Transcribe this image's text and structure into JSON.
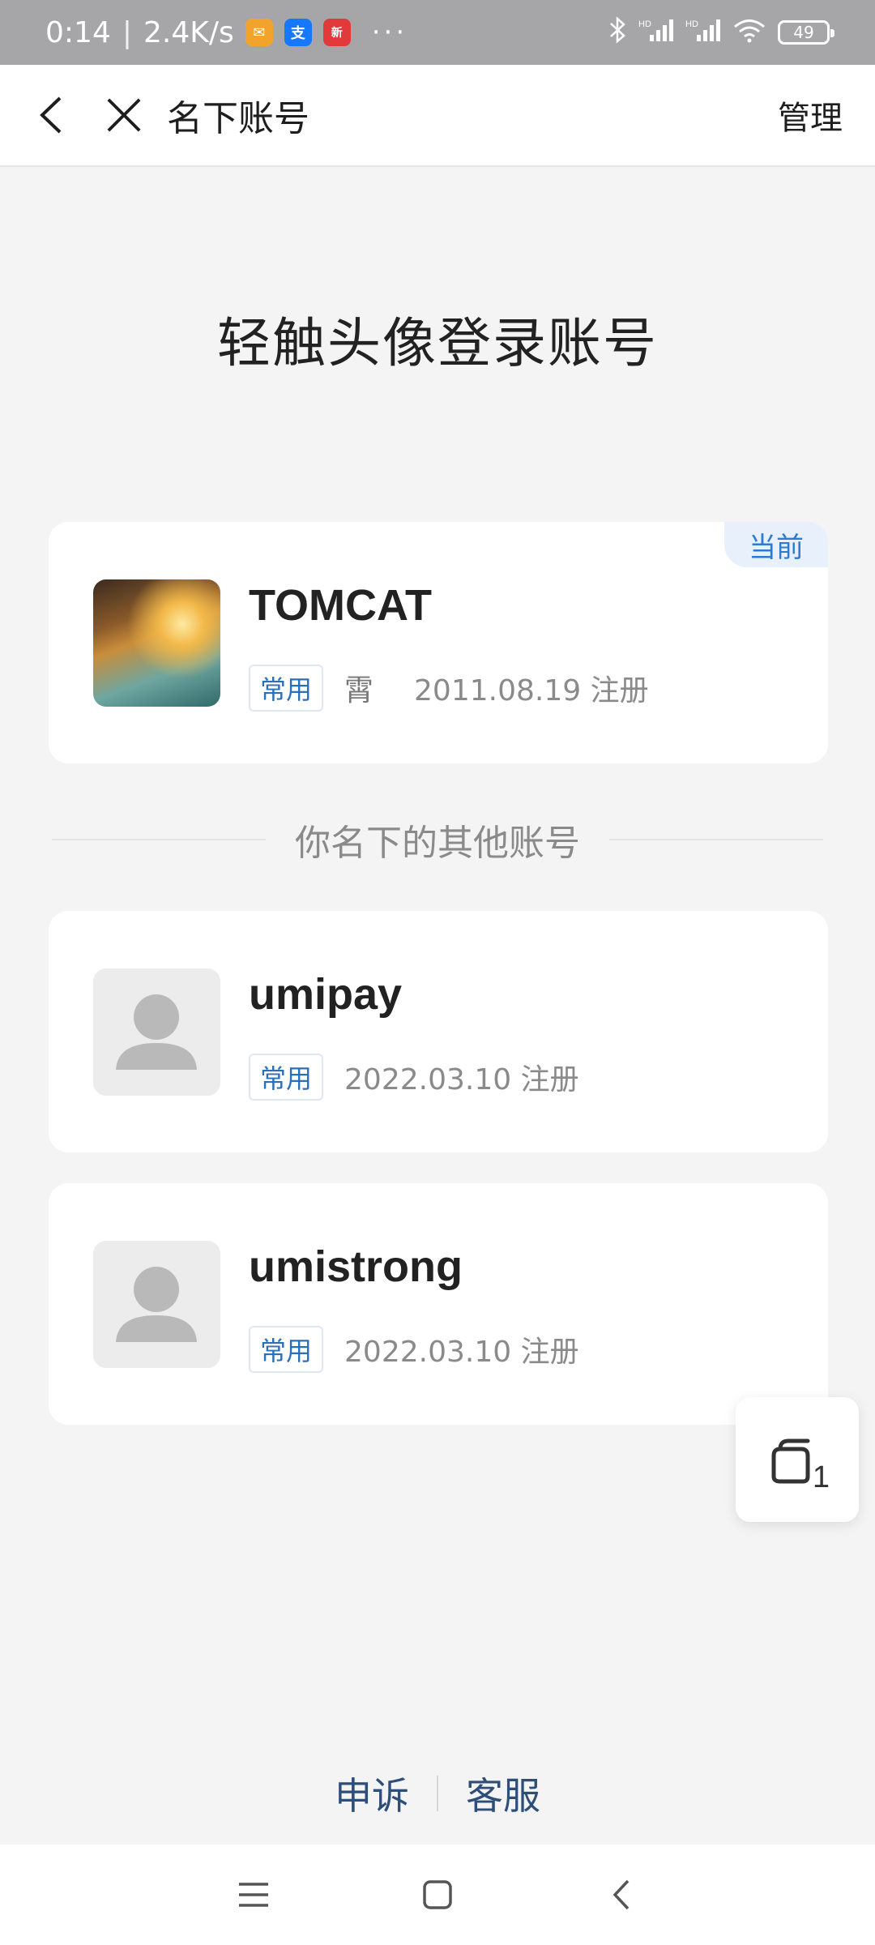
{
  "status_bar": {
    "time": "0:14",
    "speed": "2.4K/s",
    "more": "···",
    "battery": "49",
    "signal": "HD"
  },
  "nav": {
    "title": "名下账号",
    "manage": "管理"
  },
  "heading": "轻触头像登录账号",
  "current_account": {
    "badge": "当前",
    "username": "TOMCAT",
    "tag": "常用",
    "nickname": "霄",
    "registered": "2011.08.19 注册"
  },
  "divider_text": "你名下的其他账号",
  "other_accounts": [
    {
      "username": "umipay",
      "tag": "常用",
      "registered": "2022.03.10 注册"
    },
    {
      "username": "umistrong",
      "tag": "常用",
      "registered": "2022.03.10 注册"
    }
  ],
  "tabs_count": "1",
  "footer": {
    "appeal": "申诉",
    "service": "客服"
  },
  "icons": {
    "back": "chevron-left-icon",
    "close": "close-icon",
    "tabs": "tabs-icon",
    "menu": "menu-icon",
    "home": "home-icon",
    "sys_back": "back-icon"
  },
  "colors": {
    "accent": "#2d7ad0",
    "tag_text": "#2d6fb5",
    "footer_link": "#2c4e78",
    "background": "#f4f4f5"
  }
}
